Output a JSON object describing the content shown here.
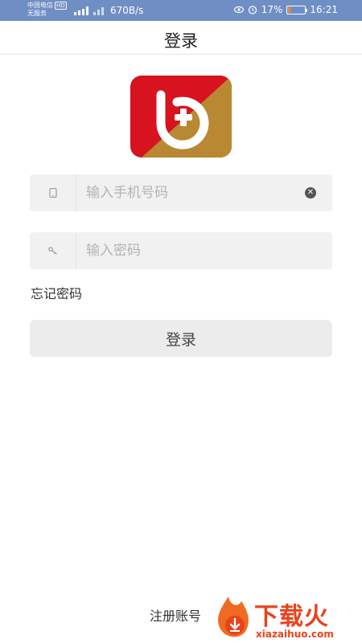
{
  "status_bar": {
    "carrier_line1": "中国电信",
    "carrier_hd": "HD",
    "carrier_line2": "无服务",
    "net_speed": "670B/s",
    "battery_percent": "17%",
    "battery_level": 0.17,
    "time": "16:21"
  },
  "header": {
    "title": "登录"
  },
  "form": {
    "phone_placeholder": "输入手机号码",
    "phone_value": "",
    "password_placeholder": "输入密码",
    "password_value": "",
    "forgot_label": "忘记密码",
    "login_label": "登录",
    "register_label": "注册账号"
  },
  "watermark": {
    "text": "下载火",
    "sub": "xiazaihuo.com"
  },
  "colors": {
    "status_bar": "#6f8fc4",
    "logo_red": "#d7131f",
    "logo_gold": "#b98832",
    "watermark": "#e8431c"
  }
}
